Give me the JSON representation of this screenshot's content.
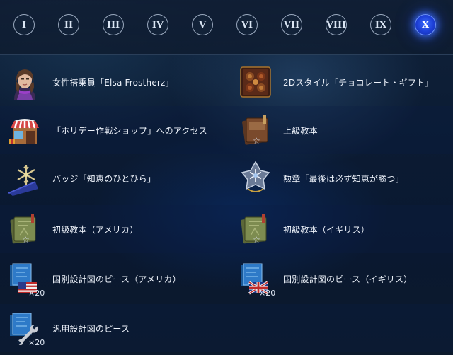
{
  "tiers": {
    "labels": [
      "I",
      "II",
      "III",
      "IV",
      "V",
      "VI",
      "VII",
      "VIII",
      "IX",
      "X"
    ],
    "active_index": 9
  },
  "rewards": {
    "row1": {
      "left": {
        "label": "女性搭乗員「Elsa Frostherz」",
        "icon": "crew-portrait-icon"
      },
      "right": {
        "label": "2Dスタイル「チョコレート・ギフト」",
        "icon": "chocolate-gift-icon"
      }
    },
    "row2": {
      "left": {
        "label": "「ホリデー作戦ショップ」へのアクセス",
        "icon": "shop-icon"
      },
      "right": {
        "label": "上級教本",
        "icon": "advanced-manual-icon"
      }
    },
    "row3": {
      "left": {
        "label": "バッジ「知恵のひとひら」",
        "icon": "snowflake-badge-icon"
      },
      "right": {
        "label": "勲章「最後は必ず知恵が勝つ」",
        "icon": "medal-icon"
      }
    },
    "row4": {
      "left": {
        "label": "初級教本（アメリカ）",
        "icon": "basic-manual-icon"
      },
      "right": {
        "label": "初級教本（イギリス）",
        "icon": "basic-manual-icon"
      }
    },
    "row5": {
      "left": {
        "label": "国別設計図のピース（アメリカ）",
        "icon": "usa-blueprint-icon",
        "qty": "×20"
      },
      "right": {
        "label": "国別設計図のピース（イギリス）",
        "icon": "uk-blueprint-icon",
        "qty": "×20"
      }
    },
    "row6": {
      "left": {
        "label": "汎用設計図のピース",
        "icon": "universal-blueprint-icon",
        "qty": "×20"
      }
    }
  }
}
